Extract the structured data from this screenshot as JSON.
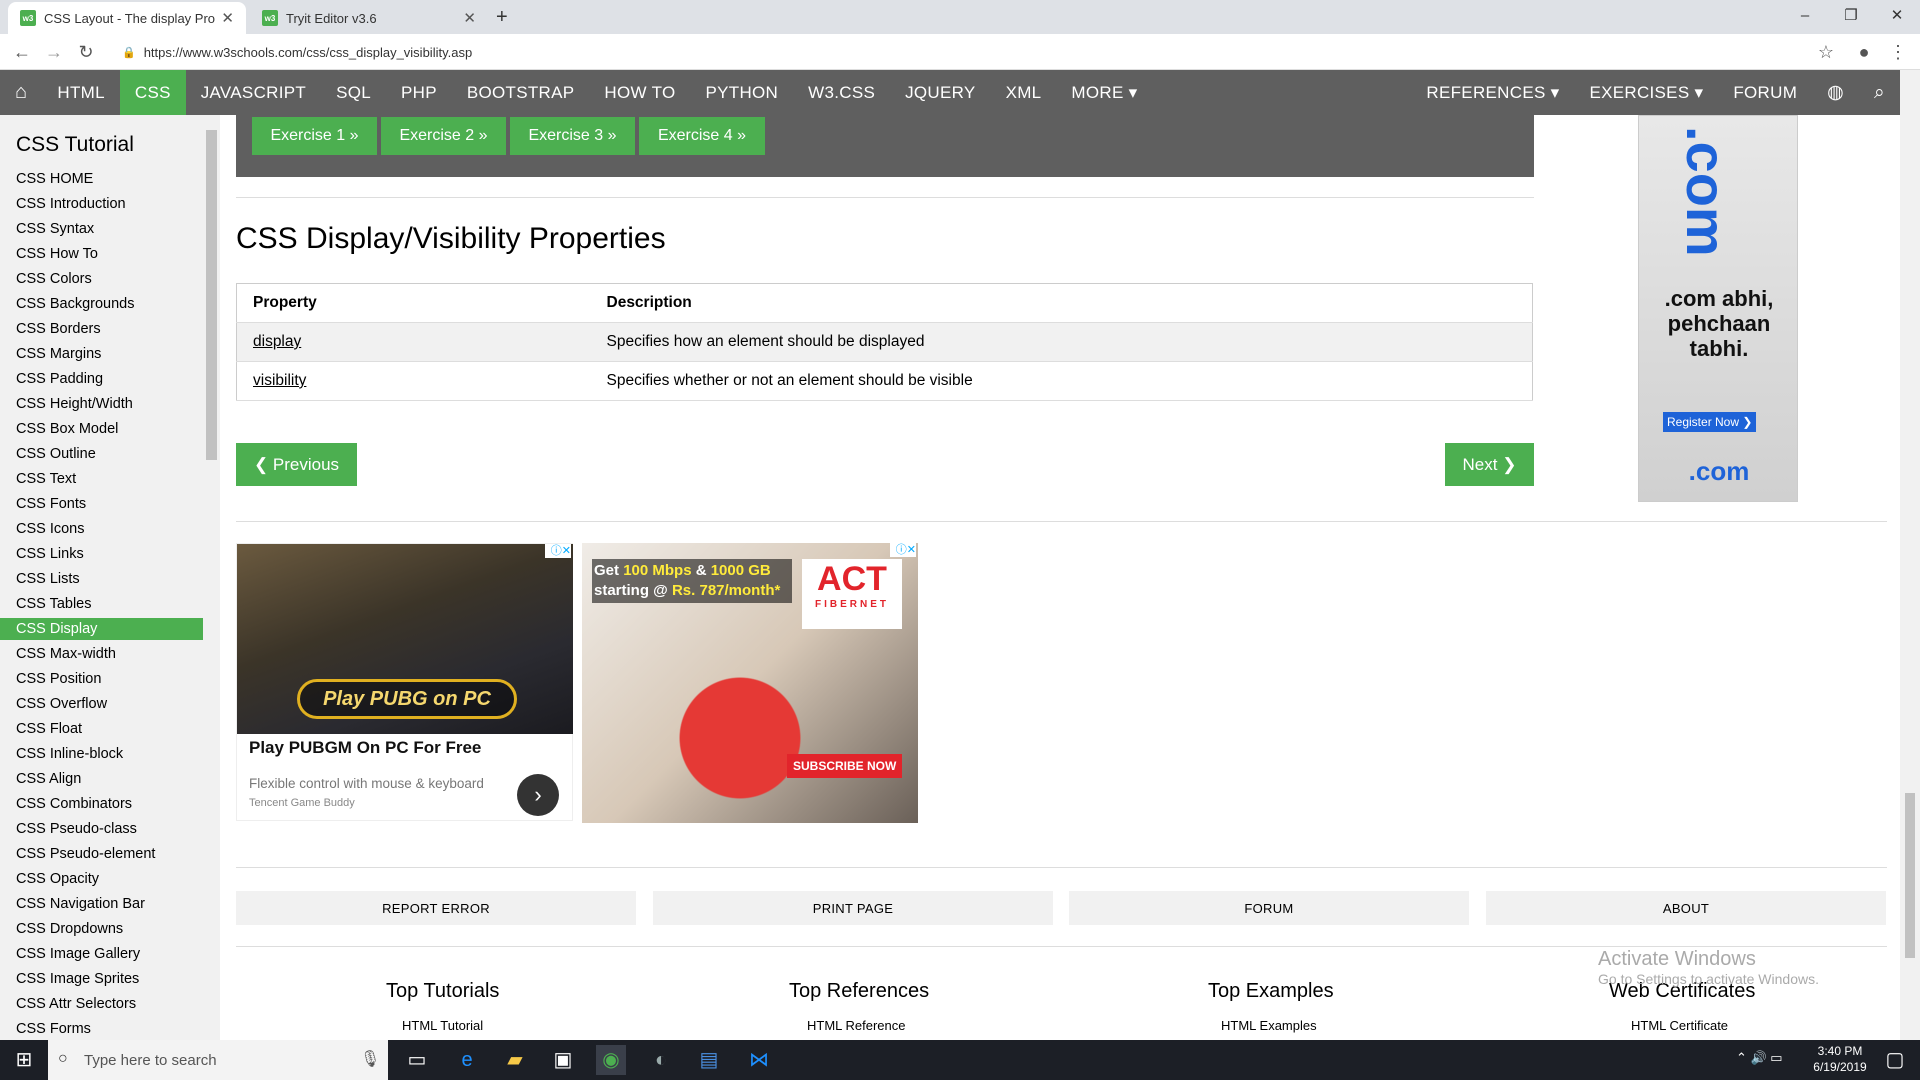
{
  "browser": {
    "tabs": [
      {
        "label": "CSS Layout - The display Propert",
        "favicon": "w3"
      },
      {
        "label": "Tryit Editor v3.6",
        "favicon": "w3"
      }
    ],
    "url": "https://www.w3schools.com/css/css_display_visibility.asp"
  },
  "topnav": {
    "items": [
      "HTML",
      "CSS",
      "JAVASCRIPT",
      "SQL",
      "PHP",
      "BOOTSTRAP",
      "HOW TO",
      "PYTHON",
      "W3.CSS",
      "JQUERY",
      "XML",
      "MORE ▾"
    ],
    "active": "CSS",
    "right_items": [
      "REFERENCES ▾",
      "EXERCISES ▾",
      "FORUM"
    ]
  },
  "sidebar": {
    "title": "CSS Tutorial",
    "items": [
      "CSS HOME",
      "CSS Introduction",
      "CSS Syntax",
      "CSS How To",
      "CSS Colors",
      "CSS Backgrounds",
      "CSS Borders",
      "CSS Margins",
      "CSS Padding",
      "CSS Height/Width",
      "CSS Box Model",
      "CSS Outline",
      "CSS Text",
      "CSS Fonts",
      "CSS Icons",
      "CSS Links",
      "CSS Lists",
      "CSS Tables",
      "CSS Display",
      "CSS Max-width",
      "CSS Position",
      "CSS Overflow",
      "CSS Float",
      "CSS Inline-block",
      "CSS Align",
      "CSS Combinators",
      "CSS Pseudo-class",
      "CSS Pseudo-element",
      "CSS Opacity",
      "CSS Navigation Bar",
      "CSS Dropdowns",
      "CSS Image Gallery",
      "CSS Image Sprites",
      "CSS Attr Selectors",
      "CSS Forms"
    ],
    "active": "CSS Display"
  },
  "exercises": [
    "Exercise 1 »",
    "Exercise 2 »",
    "Exercise 3 »",
    "Exercise 4 »"
  ],
  "section": {
    "title": "CSS Display/Visibility Properties",
    "table": {
      "headers": [
        "Property",
        "Description"
      ],
      "rows": [
        {
          "property": "display",
          "description": "Specifies how an element should be displayed"
        },
        {
          "property": "visibility",
          "description": "Specifies whether or not an element should be visible"
        }
      ]
    }
  },
  "pager": {
    "previous": "❮ Previous",
    "next": "Next ❯"
  },
  "ads": {
    "ad1": {
      "overlay": "Play PUBG on PC",
      "title": "Play PUBGM On PC For Free",
      "subtitle": "Flexible control with mouse & keyboard",
      "brand": "Tencent Game Buddy"
    },
    "ad2": {
      "headline_a": "Get ",
      "speed": "100 Mbps",
      "headline_b": " & ",
      "data": "1000 GB",
      "headline_c": "starting @ ",
      "price": "Rs. 787/month*",
      "logo_big": "ACT",
      "logo_small": "FIBERNET",
      "cta": "SUBSCRIBE NOW"
    },
    "ad3": {
      "vertical": ".com",
      "text": ".com abhi, pehchaan tabhi.",
      "cta": "Register Now ❯",
      "footer": ".com"
    }
  },
  "footer": {
    "buttons": [
      "REPORT ERROR",
      "PRINT PAGE",
      "FORUM",
      "ABOUT"
    ],
    "columns": [
      {
        "title": "Top Tutorials",
        "link": "HTML Tutorial"
      },
      {
        "title": "Top References",
        "link": "HTML Reference"
      },
      {
        "title": "Top Examples",
        "link": "HTML Examples"
      },
      {
        "title": "Web Certificates",
        "link": "HTML Certificate"
      }
    ]
  },
  "watermark": {
    "line1": "Activate Windows",
    "line2": "Go to Settings to activate Windows."
  },
  "taskbar": {
    "search_placeholder": "Type here to search",
    "time": "3:40 PM",
    "date": "6/19/2019"
  },
  "colors": {
    "accent": "#4caf50",
    "nav": "#5f5f5f",
    "sidebar": "#f1f1f1"
  }
}
